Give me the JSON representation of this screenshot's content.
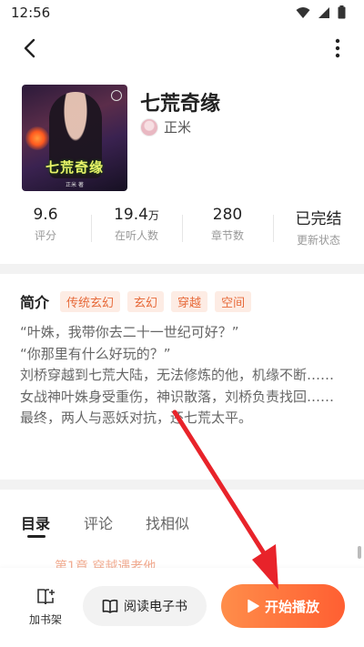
{
  "status_bar": {
    "time": "12:56"
  },
  "book": {
    "title": "七荒奇缘",
    "author": "正米",
    "cover_title": "七荒奇缘",
    "cover_author": "正米 著"
  },
  "stats": [
    {
      "value": "9.6",
      "unit": "",
      "label": "评分"
    },
    {
      "value": "19.4",
      "unit": "万",
      "label": "在听人数"
    },
    {
      "value": "280",
      "unit": "",
      "label": "章节数"
    },
    {
      "value": "已完结",
      "unit": "",
      "label": "更新状态"
    }
  ],
  "intro": {
    "title": "简介",
    "tags": [
      "传统玄幻",
      "玄幻",
      "穿越",
      "空间"
    ],
    "lines": [
      "“叶姝，我带你去二十一世纪可好？”",
      "“你那里有什么好玩的？”",
      "刘桥穿越到七荒大陆，无法修炼的他，机缘不断……",
      "女战神叶姝身受重伤，神识散落，刘桥负责找回……",
      "最终，两人与恶妖对抗，还七荒太平。"
    ]
  },
  "tabs": [
    "目录",
    "评论",
    "找相似"
  ],
  "active_tab": "目录",
  "list_peek": "第1章 穿越遇老他",
  "bottom_bar": {
    "shelf_label": "加书架",
    "read_label": "阅读电子书",
    "play_label": "开始播放"
  },
  "colors": {
    "accent": "#ff6a3a",
    "tag_text": "#e76a3a",
    "tag_bg": "#fdece4",
    "annotation_arrow": "#e8232a"
  }
}
